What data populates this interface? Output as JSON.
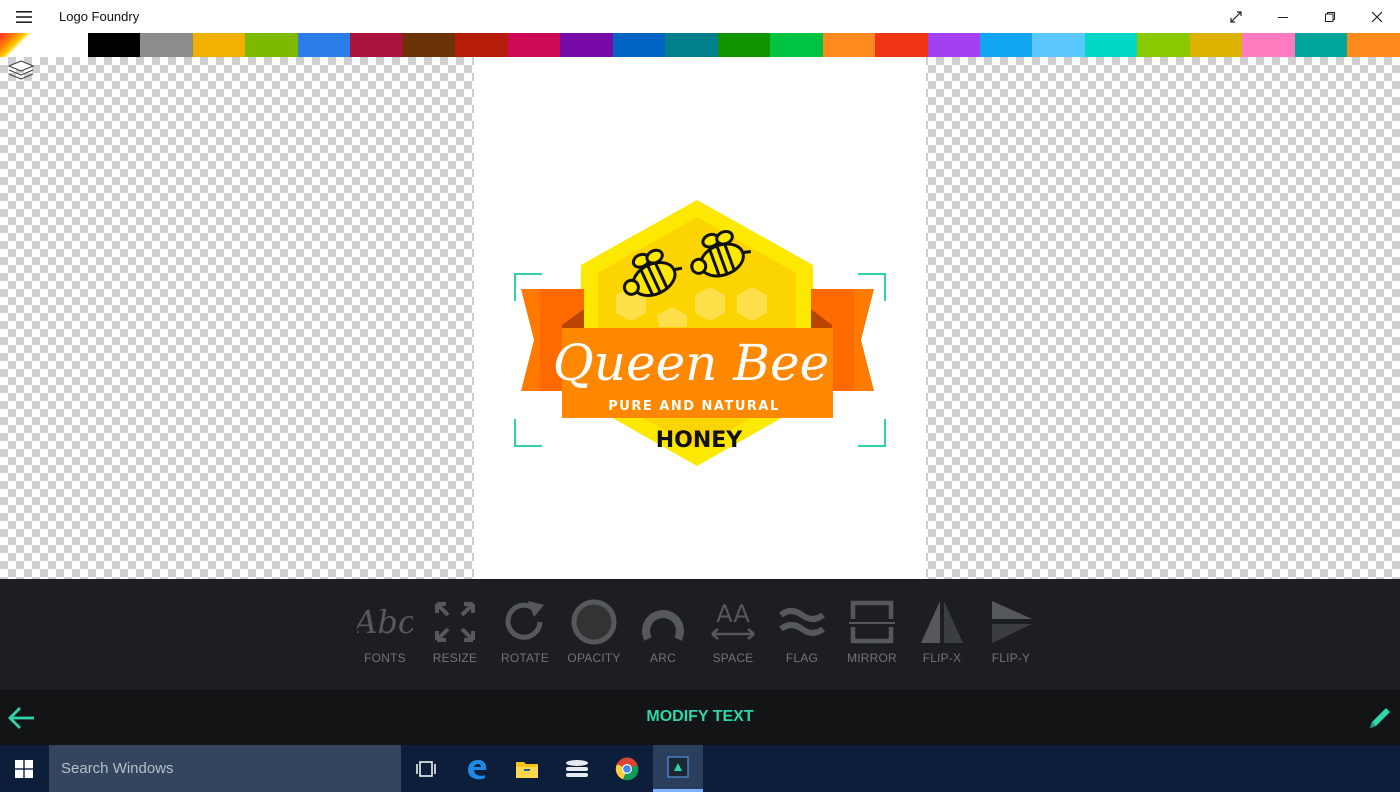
{
  "window": {
    "title": "Logo Foundry",
    "icons": {
      "menu": "hamburger-icon",
      "fullscreen": "expand-icon",
      "minimize": "minimize-icon",
      "restore": "restore-icon",
      "close": "close-icon"
    }
  },
  "palette": {
    "colors": [
      "#ffffff",
      "#000000",
      "#8c8c8c",
      "#f2b100",
      "#7cb900",
      "#2d7de8",
      "#a8123b",
      "#6a3205",
      "#b51d0a",
      "#cc0a55",
      "#780aa8",
      "#0064c4",
      "#00808a",
      "#129400",
      "#00c342",
      "#ff8b20",
      "#f03514",
      "#a340f2",
      "#12a5f2",
      "#5ac7ff",
      "#00d7c5",
      "#8ac800",
      "#dcb100",
      "#ff7abf",
      "#00a59c",
      "#ff8a1c"
    ]
  },
  "canvas": {
    "layers_icon": "layers-icon",
    "logo": {
      "title": "Queen Bee",
      "tagline": "PURE AND NATURAL",
      "subtitle": "HONEY",
      "colors": {
        "hex_outer": "#fde800",
        "hex_inner": "#fcd400",
        "cells": "#ffe04a",
        "ribbon": "#ff7a00",
        "ribbon_dark": "#e85e00",
        "ribbon_fold": "#b84400",
        "banner": "#ff8800",
        "text_light": "#ffffff",
        "text_dark": "#111111",
        "corner_marks": "#2fcfb0"
      }
    }
  },
  "tools": [
    {
      "label": "FONTS",
      "icon": "fonts-icon"
    },
    {
      "label": "RESIZE",
      "icon": "resize-icon"
    },
    {
      "label": "ROTATE",
      "icon": "rotate-icon"
    },
    {
      "label": "OPACITY",
      "icon": "opacity-icon"
    },
    {
      "label": "ARC",
      "icon": "arc-icon"
    },
    {
      "label": "SPACE",
      "icon": "space-icon"
    },
    {
      "label": "FLAG",
      "icon": "flag-icon"
    },
    {
      "label": "MIRROR",
      "icon": "mirror-icon"
    },
    {
      "label": "FLIP-X",
      "icon": "flip-x-icon"
    },
    {
      "label": "FLIP-Y",
      "icon": "flip-y-icon"
    }
  ],
  "action_bar": {
    "title": "MODIFY TEXT",
    "accent": "#2fd6ac",
    "back_icon": "arrow-left-icon",
    "edit_icon": "pencil-icon"
  },
  "taskbar": {
    "search_placeholder": "Search Windows",
    "apps": [
      "windows-start-icon",
      "task-view-icon",
      "edge-icon",
      "file-explorer-icon",
      "storage-icon",
      "chrome-icon",
      "logo-foundry-icon"
    ],
    "active_app": "logo-foundry-icon"
  }
}
